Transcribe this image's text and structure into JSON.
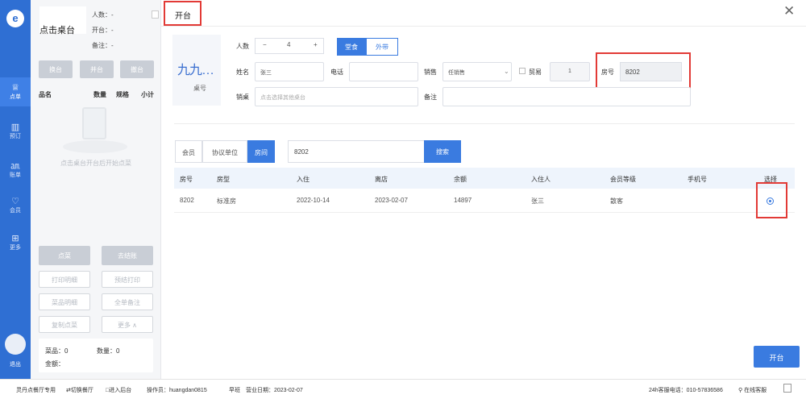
{
  "rail": {
    "logo": "e",
    "items": [
      {
        "label": "点单",
        "glyph": "♕",
        "active": true
      },
      {
        "label": "预订",
        "glyph": "▥",
        "active": false
      },
      {
        "label": "账单",
        "glyph": "㏂",
        "active": false
      },
      {
        "label": "会员",
        "glyph": "♡",
        "active": false
      },
      {
        "label": "更多",
        "glyph": "⊞",
        "active": false
      }
    ],
    "logout": "退出"
  },
  "left_panel": {
    "table_name": "点击桌台",
    "people": "人数：-",
    "open": "开台：-",
    "note": "备注：-",
    "actions": [
      "换台",
      "并台",
      "撤台"
    ],
    "headers": {
      "name": "品名",
      "qty": "数量",
      "spec": "规格",
      "subtotal": "小计"
    },
    "empty_text": "点击桌台开台后开始点菜",
    "primary_actions": [
      "点菜",
      "去结账"
    ],
    "buttons": [
      "打印明细",
      "预结打印",
      "菜品明细",
      "全单备注",
      "复制点菜",
      "更多 ∧"
    ],
    "totals": {
      "items": "菜品：0",
      "qty": "数量：0",
      "amount": "金额："
    }
  },
  "main": {
    "title": "开台",
    "close": "✕",
    "desk": {
      "name": "九九…",
      "label": "桌号"
    },
    "form": {
      "people_label": "人数",
      "people_minus": "−",
      "people_value": "4",
      "people_plus": "+",
      "mode": [
        "堂食",
        "外带"
      ],
      "name_label": "姓名",
      "name_value": "张三",
      "phone_label": "电话",
      "phone_value": "",
      "sales_label": "销售",
      "sales_value": "任销售",
      "vip_label": "贸易",
      "vip_count": "1",
      "room_label": "房号",
      "room_value": "8202",
      "desk_label": "销桌",
      "desk_placeholder": "点击选择其他桌台",
      "remark_label": "备注",
      "remark_value": ""
    },
    "search": {
      "types": [
        "会员",
        "协议单位",
        "房间"
      ],
      "value": "8202",
      "button": "搜索"
    },
    "table": {
      "headers": [
        "房号",
        "房型",
        "入住",
        "离店",
        "余额",
        "入住人",
        "会员等级",
        "手机号",
        "选择"
      ],
      "rows": [
        [
          "8202",
          "标准房",
          "2022-10-14",
          "2023-02-07",
          "14897",
          "张三",
          "散客",
          ""
        ]
      ]
    },
    "open_button": "开台"
  },
  "statusbar": {
    "product": "灵丹点餐厅专用",
    "switch": "⇄切换餐厅",
    "enter": "□进入后台",
    "operator": "操作员：huangdan0815",
    "shift": "早班",
    "biz_date": "营业日期：2023-02-07",
    "hotline": "24h客服电话：010-57836586",
    "online": "⚲ 在线客服"
  },
  "colors": {
    "accent": "#3a7be0",
    "rail": "#2f6fd3",
    "highlight": "#e23a36"
  }
}
